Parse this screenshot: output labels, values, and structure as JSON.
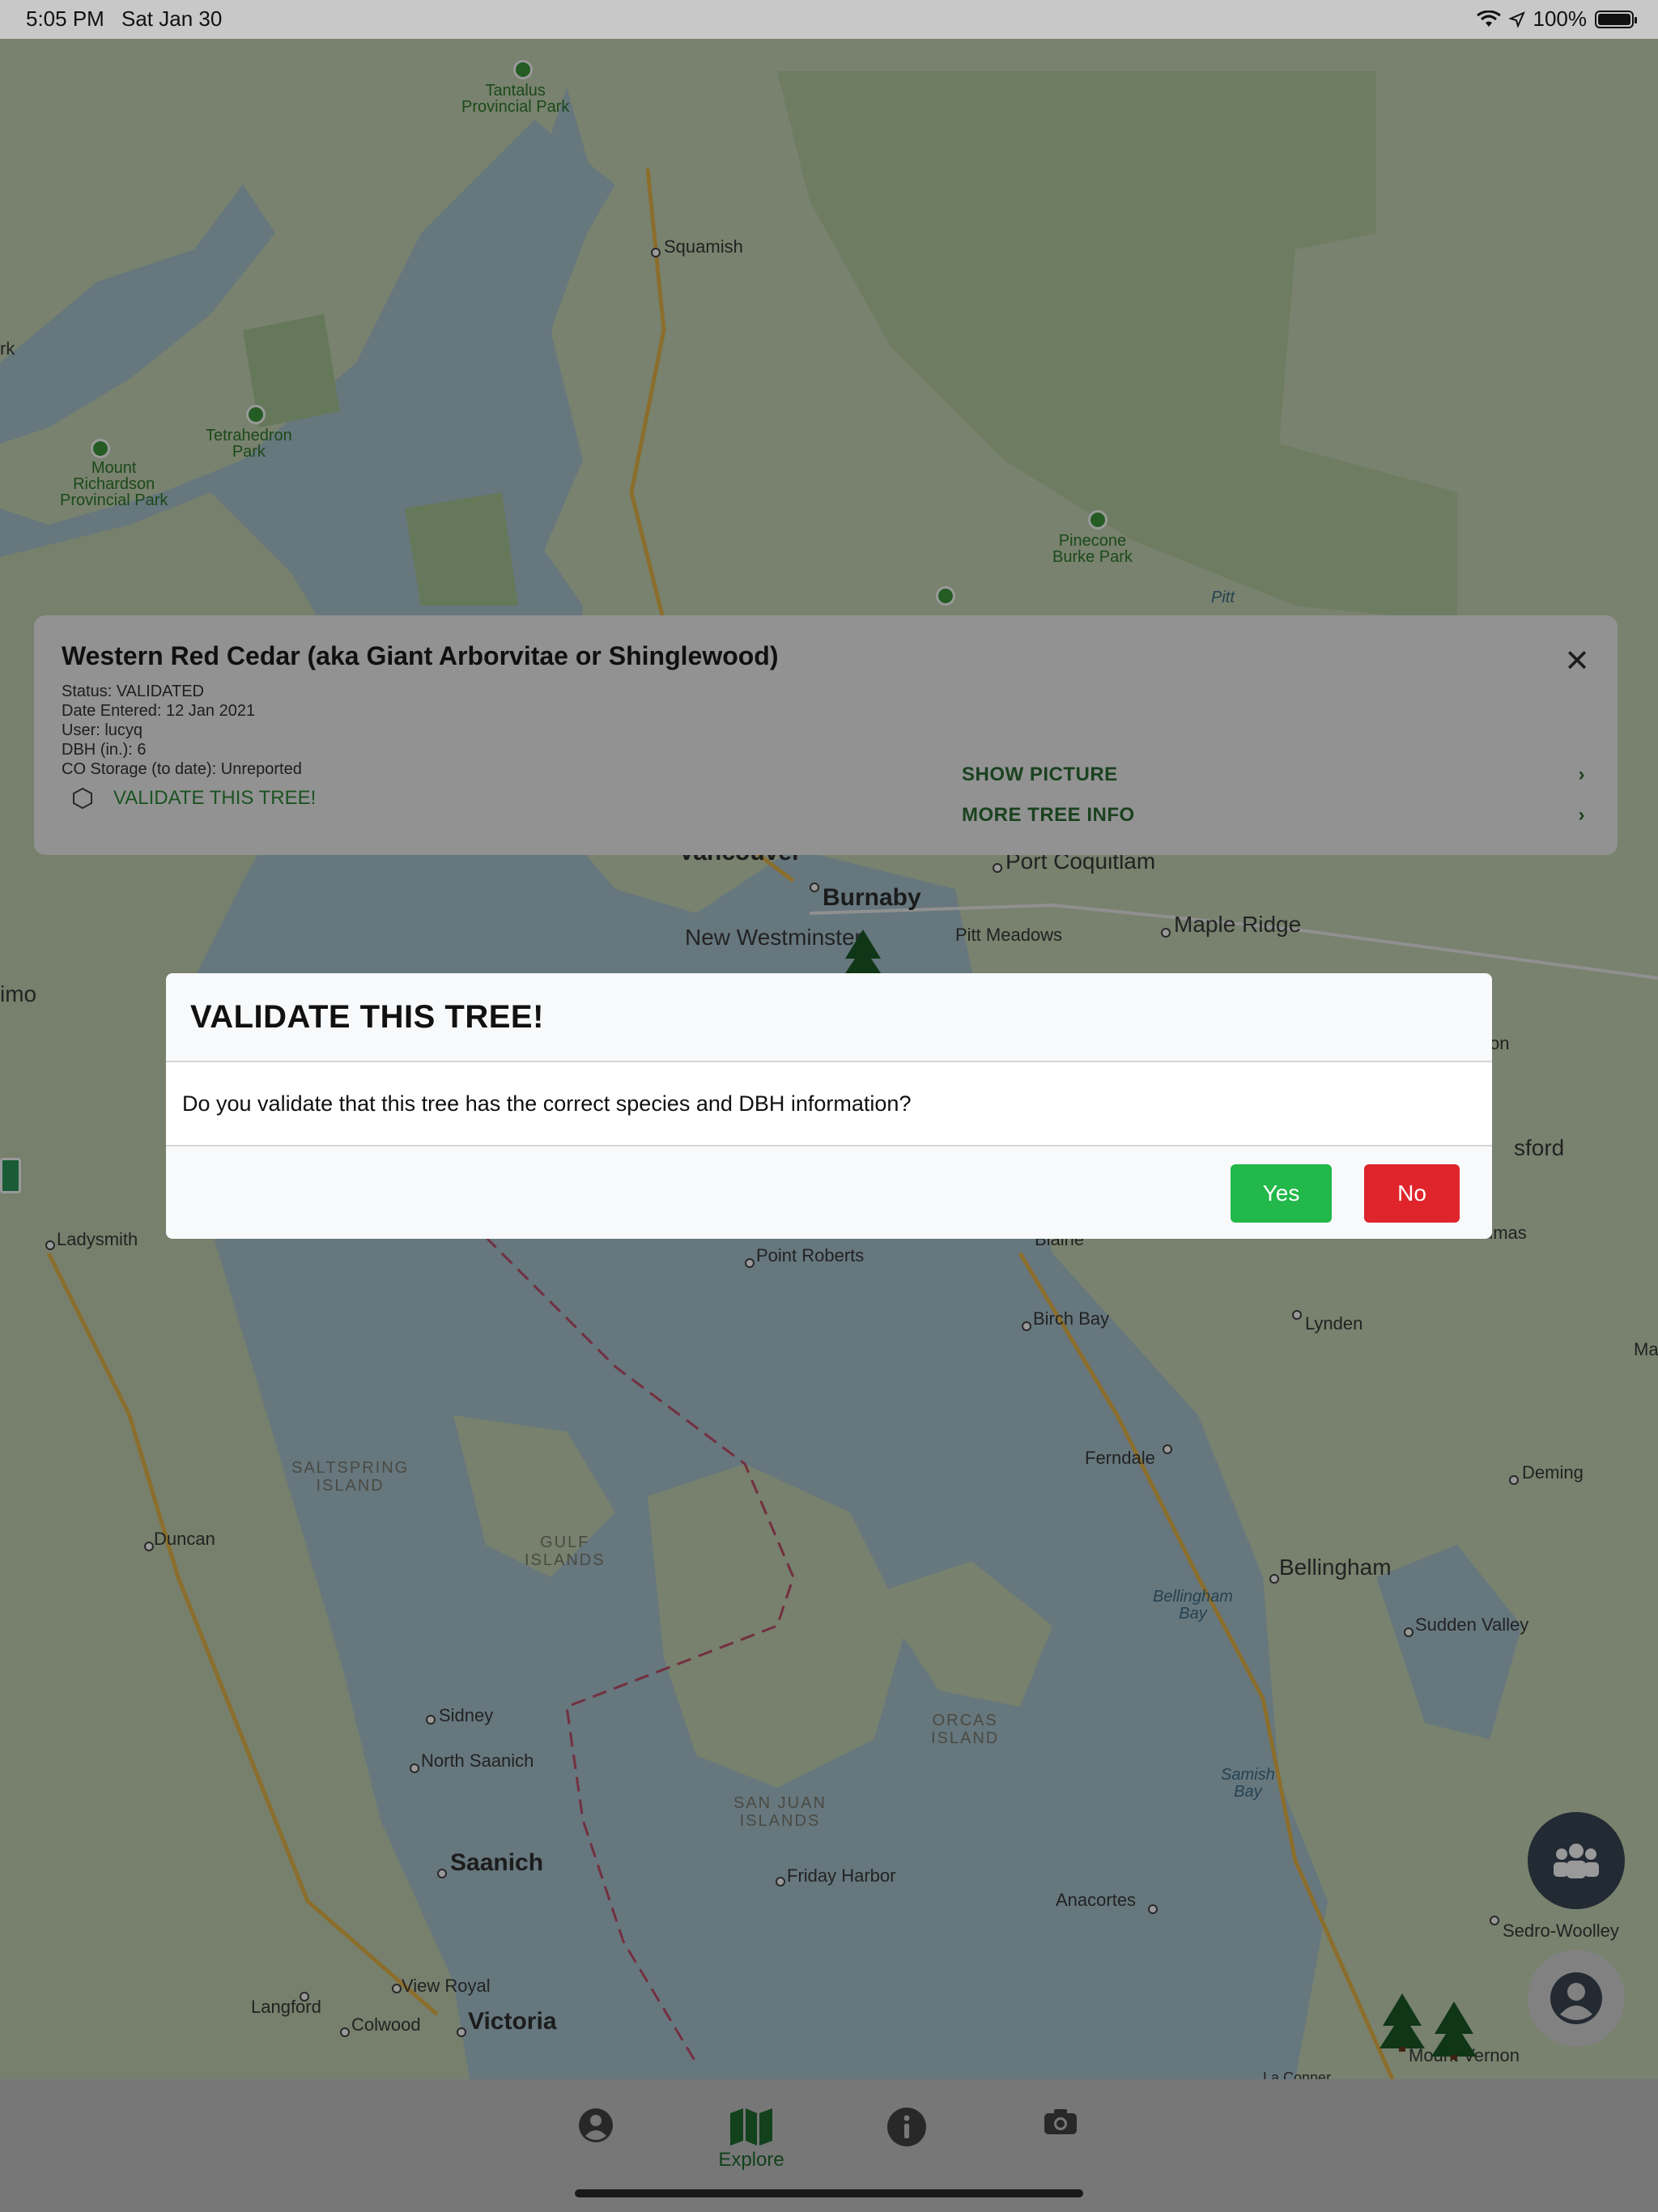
{
  "status_bar": {
    "time": "5:05 PM",
    "date": "Sat Jan 30",
    "battery": "100%",
    "icons": [
      "wifi-icon",
      "location-arrow-icon",
      "battery-icon"
    ]
  },
  "map": {
    "labels": {
      "tantalus": "Tantalus\nProvincial Park",
      "squamish": "Squamish",
      "tetrahedron": "Tetrahedron\nPark",
      "mount_richardson": "Mount\nRichardson\nProvincial Park",
      "pinecone": "Pinecone\nBurke Park",
      "pitt": "Pitt",
      "vancouver": "Vancouver",
      "port_coquitlam": "Port Coquitlam",
      "burnaby": "Burnaby",
      "new_westminster": "New Westminster",
      "pitt_meadows": "Pitt Meadows",
      "maple_ridge": "Maple Ridge",
      "nanaimo": "imo",
      "abbotsford": "sford",
      "ladysmith": "Ladysmith",
      "point_roberts": "Point Roberts",
      "blaine": "Blaine",
      "sumas": "umas",
      "birch_bay": "Birch Bay",
      "lynden": "Lynden",
      "saltspring": "SALTSPRING\nISLAND",
      "ferndale": "Ferndale",
      "deming": "Deming",
      "duncan": "Duncan",
      "gulf_islands": "GULF\nISLANDS",
      "bellingham": "Bellingham",
      "bellingham_bay": "Bellingham\nBay",
      "sudden_valley": "Sudden Valley",
      "orcas": "ORCAS\nISLAND",
      "sidney": "Sidney",
      "north_saanich": "North Saanich",
      "san_juan": "SAN JUAN\nISLANDS",
      "samish_bay": "Samish\nBay",
      "saanich": "Saanich",
      "friday_harbor": "Friday Harbor",
      "anacortes": "Anacortes",
      "sedro_woolley": "Sedro-Woolley",
      "langford": "Langford",
      "view_royal": "View Royal",
      "colwood": "Colwood",
      "victoria": "Victoria",
      "mount_vernon": "Mount Vernon",
      "la_conner": "La Conner",
      "ma": "Ma",
      "ark": "rk",
      "on": "on"
    }
  },
  "info_card": {
    "title": "Western Red Cedar (aka Giant Arborvitae or Shinglewood)",
    "status": "Status: VALIDATED",
    "date_entered": "Date Entered: 12 Jan 2021",
    "user": "User: lucyq",
    "dbh": "DBH (in.): 6",
    "co_storage": "CO Storage (to date): Unreported",
    "validate_label": "VALIDATE THIS TREE!",
    "show_picture": "SHOW PICTURE",
    "more_info": "MORE TREE INFO",
    "close_glyph": "✕",
    "chevron": "›"
  },
  "modal": {
    "title": "VALIDATE THIS TREE!",
    "body": "Do you validate that this tree has the correct species and DBH information?",
    "yes_label": "Yes",
    "no_label": "No"
  },
  "tab_bar": {
    "tabs": [
      {
        "icon": "user-circle-icon",
        "label": ""
      },
      {
        "icon": "map-icon",
        "label": "Explore"
      },
      {
        "icon": "info-icon",
        "label": ""
      },
      {
        "icon": "camera-icon",
        "label": ""
      }
    ],
    "active_color": "#1f6d2f"
  },
  "colors": {
    "accent_green": "#2e8b3a",
    "yes_green": "#22b84a",
    "no_red": "#e0242c"
  }
}
